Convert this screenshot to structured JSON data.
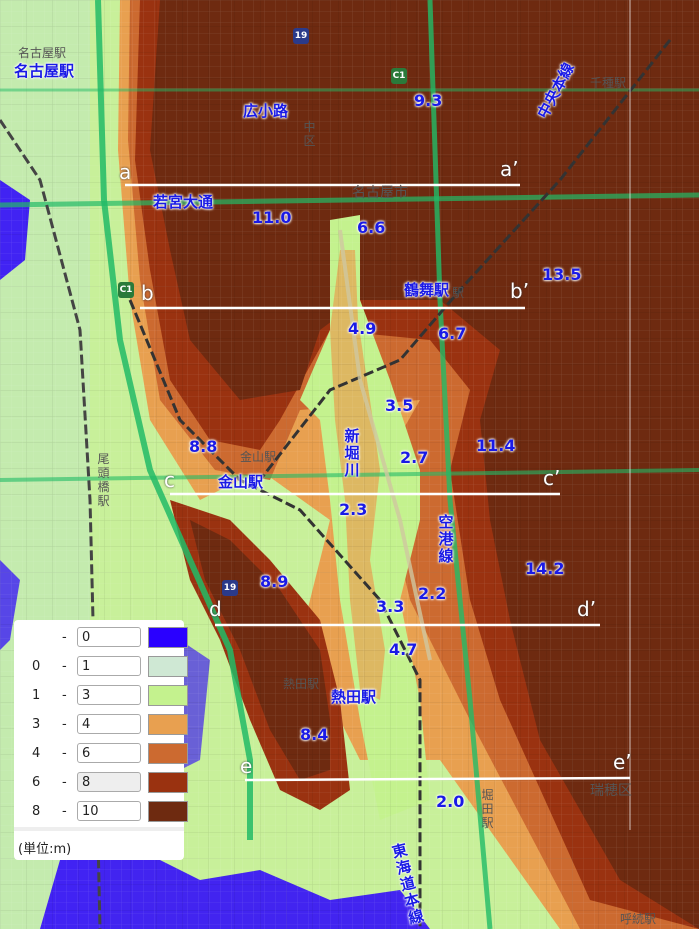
{
  "elevation_values": [
    "9.3",
    "11.0",
    "6.6",
    "13.5",
    "4.9",
    "6.7",
    "3.5",
    "8.8",
    "2.7",
    "11.4",
    "2.3",
    "8.9",
    "2.2",
    "14.2",
    "3.3",
    "4.7",
    "8.4",
    "2.0"
  ],
  "place_labels": {
    "hirokoji": "広小路",
    "wakamiya": "若宮大通",
    "tsurumai": "鶴舞駅",
    "kanayama": "金山駅",
    "atsuta": "熱田駅",
    "nagoya": "名古屋駅",
    "shinhorikawa": "新堀川",
    "kuko": "空港線",
    "chuo": "中央本線",
    "tokaido": "東海道本線"
  },
  "base_labels": {
    "naka_ku": "中区",
    "nagoya_city": "名古屋市",
    "nagoya_eki_small": "名古屋駅",
    "sentai": "千種駅",
    "eki": "駅",
    "kanayama_small": "金山駅",
    "atsuta_small": "熱田駅",
    "otobashi": "尾頭橋駅",
    "horita": "堀田駅",
    "mizuho": "瑞穂区",
    "yobitsugi": "呼続駅",
    "route19": "19",
    "routeC1": "C1"
  },
  "sections": {
    "a": "a",
    "a2": "a’",
    "b": "b",
    "b2": "b’",
    "c": "c",
    "c2": "c’",
    "d": "d",
    "d2": "d’",
    "e": "e",
    "e2": "e’"
  },
  "legend": {
    "rows": [
      {
        "from": "",
        "to": "0",
        "color": "#2a00ff"
      },
      {
        "from": "0",
        "to": "1",
        "color": "#cfe8d4"
      },
      {
        "from": "1",
        "to": "3",
        "color": "#c4f28e"
      },
      {
        "from": "3",
        "to": "4",
        "color": "#e8a050"
      },
      {
        "from": "4",
        "to": "6",
        "color": "#cc6a30"
      },
      {
        "from": "6",
        "to": "8",
        "color": "#9a3210"
      },
      {
        "from": "8",
        "to": "10",
        "color": "#6e2a10"
      }
    ],
    "unit": "(単位:m)"
  }
}
